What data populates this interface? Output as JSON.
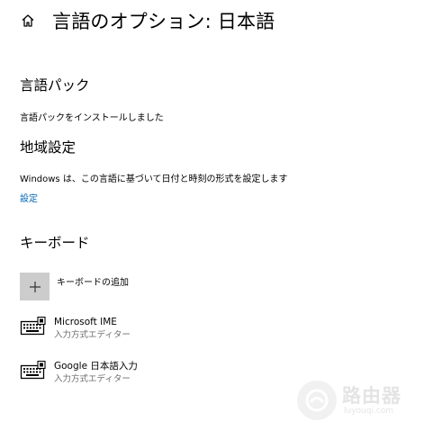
{
  "header": {
    "title": "言語のオプション: 日本語"
  },
  "language_pack": {
    "heading": "言語パック",
    "status": "言語パックをインストールしました"
  },
  "regional": {
    "heading": "地域設定",
    "description": "Windows は、この言語に基づいて日付と時刻の形式を設定します",
    "link": "設定"
  },
  "keyboard": {
    "heading": "キーボード",
    "add_label": "キーボードの追加",
    "items": [
      {
        "name": "Microsoft IME",
        "subtitle": "入力方式エディター"
      },
      {
        "name": "Google 日本語入力",
        "subtitle": "入力方式エディター"
      }
    ]
  },
  "watermark": {
    "cn": "路由器",
    "en": "luyouqi.com"
  },
  "colors": {
    "link": "#0067b8",
    "tile": "#cccccc",
    "subtext": "#6d6d6d"
  }
}
